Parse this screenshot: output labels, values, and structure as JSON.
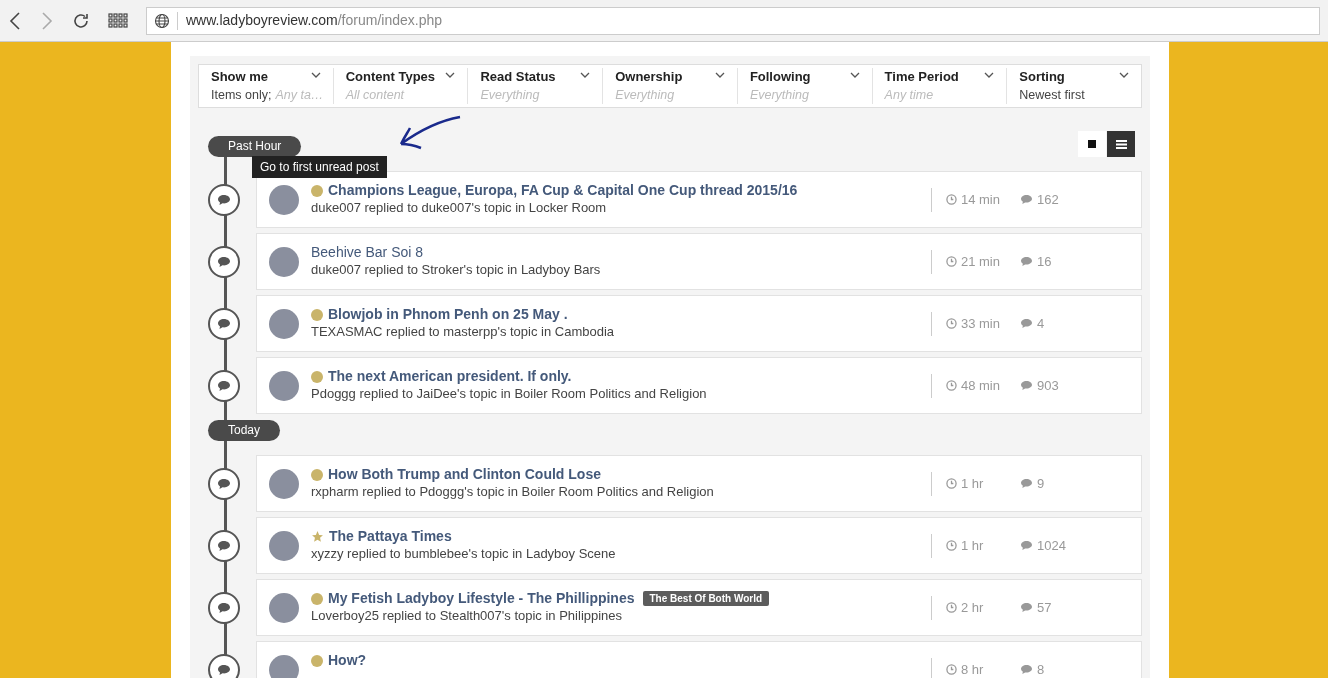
{
  "browser": {
    "url_host": "www.ladyboyreview.com",
    "url_path": "/forum/index.php"
  },
  "filters": [
    {
      "title": "Show me",
      "value": "Items only;",
      "hint": "Any ta…"
    },
    {
      "title": "Content Types",
      "hint": "All content"
    },
    {
      "title": "Read Status",
      "hint": "Everything"
    },
    {
      "title": "Ownership",
      "hint": "Everything"
    },
    {
      "title": "Following",
      "hint": "Everything"
    },
    {
      "title": "Time Period",
      "hint": "Any time"
    },
    {
      "title": "Sorting",
      "value": "Newest first"
    }
  ],
  "view_toggle": [
    {
      "kind": "condensed",
      "selected": false
    },
    {
      "kind": "expanded",
      "selected": true
    }
  ],
  "tooltip": "Go to first unread post",
  "sections": [
    {
      "label": "Past Hour",
      "rows": [
        {
          "kind": "unread",
          "title": "Champions League, Europa, FA Cup & Capital One Cup thread 2015/16",
          "meta": "duke007 replied to duke007's topic in Locker Room",
          "time": "14 min",
          "replies": "162"
        },
        {
          "kind": "read",
          "title": "Beehive Bar Soi 8",
          "meta": "duke007 replied to Stroker's topic in Ladyboy Bars",
          "time": "21 min",
          "replies": "16"
        },
        {
          "kind": "unread",
          "title": "Blowjob in Phnom Penh on 25 May .",
          "meta": "TEXASMAC replied to masterpp's topic in Cambodia",
          "time": "33 min",
          "replies": "4"
        },
        {
          "kind": "unread",
          "title": "The next American president. If only.",
          "meta": "Pdoggg replied to JaiDee's topic in Boiler Room Politics and Religion",
          "time": "48 min",
          "replies": "903"
        }
      ]
    },
    {
      "label": "Today",
      "rows": [
        {
          "kind": "unread",
          "title": "How Both Trump and Clinton Could Lose",
          "meta": "rxpharm replied to Pdoggg's topic in Boiler Room Politics and Religion",
          "time": "1 hr",
          "replies": "9"
        },
        {
          "kind": "featured",
          "title": "The Pattaya Times",
          "meta": "xyzzy replied to bumblebee's topic in Ladyboy Scene",
          "time": "1 hr",
          "replies": "1024"
        },
        {
          "kind": "unread",
          "title": "My Fetish Ladyboy Lifestyle - The Phillippines",
          "tag": "The Best Of Both World",
          "meta": "Loverboy25 replied to Stealth007's topic in Philippines",
          "time": "2 hr",
          "replies": "57"
        },
        {
          "kind": "unread",
          "title": "How?",
          "time": "8 hr",
          "replies": "8"
        }
      ]
    }
  ]
}
